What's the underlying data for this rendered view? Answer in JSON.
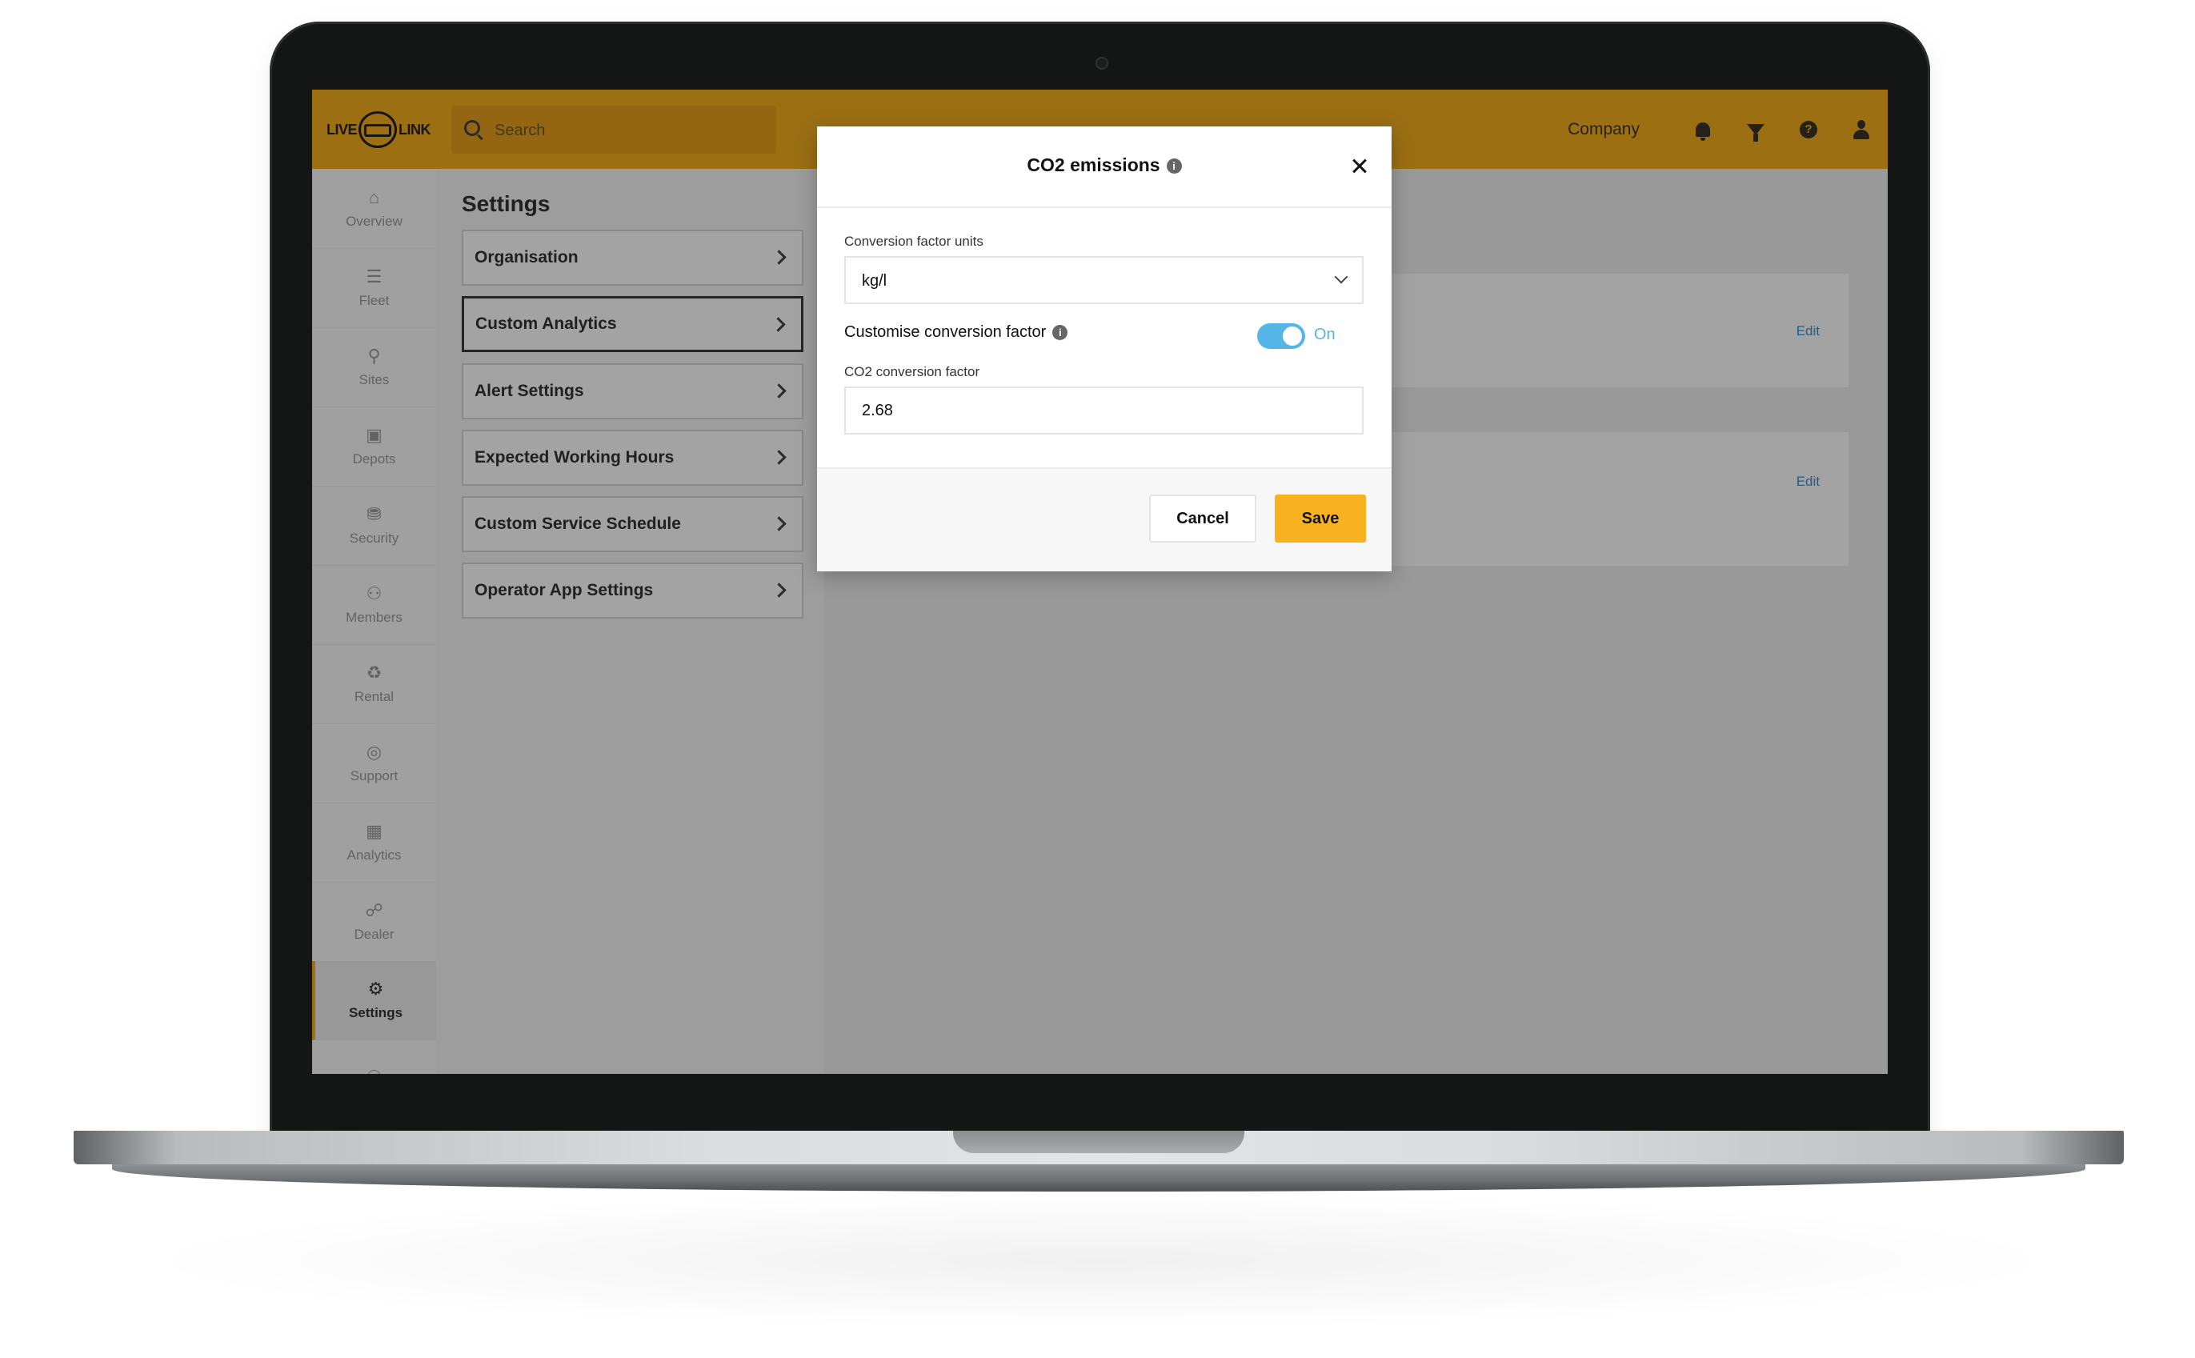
{
  "header": {
    "logo_text_left": "LIVE",
    "logo_text_right": "LINK",
    "search_placeholder": "Search",
    "company_label": "Company"
  },
  "sidebar": {
    "items": [
      {
        "label": "Overview",
        "icon": "home-icon"
      },
      {
        "label": "Fleet",
        "icon": "list-icon"
      },
      {
        "label": "Sites",
        "icon": "map-pin-icon"
      },
      {
        "label": "Depots",
        "icon": "warehouse-icon"
      },
      {
        "label": "Security",
        "icon": "lock-icon"
      },
      {
        "label": "Members",
        "icon": "users-icon"
      },
      {
        "label": "Rental",
        "icon": "rental-icon"
      },
      {
        "label": "Support",
        "icon": "support-icon"
      },
      {
        "label": "Analytics",
        "icon": "chart-icon"
      },
      {
        "label": "Dealer",
        "icon": "handshake-icon"
      },
      {
        "label": "Settings",
        "icon": "gear-icon",
        "active": true
      }
    ]
  },
  "settings": {
    "title": "Settings",
    "items": [
      {
        "label": "Organisation"
      },
      {
        "label": "Custom Analytics",
        "selected": true
      },
      {
        "label": "Alert Settings"
      },
      {
        "label": "Expected Working Hours"
      },
      {
        "label": "Custom Service Schedule"
      },
      {
        "label": "Operator App Settings"
      }
    ]
  },
  "content": {
    "edit_label_1": "Edit",
    "edit_label_2": "Edit"
  },
  "modal": {
    "title": "CO2 emissions",
    "units_label": "Conversion factor units",
    "units_value": "kg/l",
    "customise_label": "Customise conversion factor",
    "toggle_state": "On",
    "factor_label": "CO2 conversion factor",
    "factor_value": "2.68",
    "cancel_label": "Cancel",
    "save_label": "Save"
  },
  "colors": {
    "brand": "#f5ae1e",
    "toggle_on": "#54b5e6",
    "link": "#3a8fd1"
  }
}
